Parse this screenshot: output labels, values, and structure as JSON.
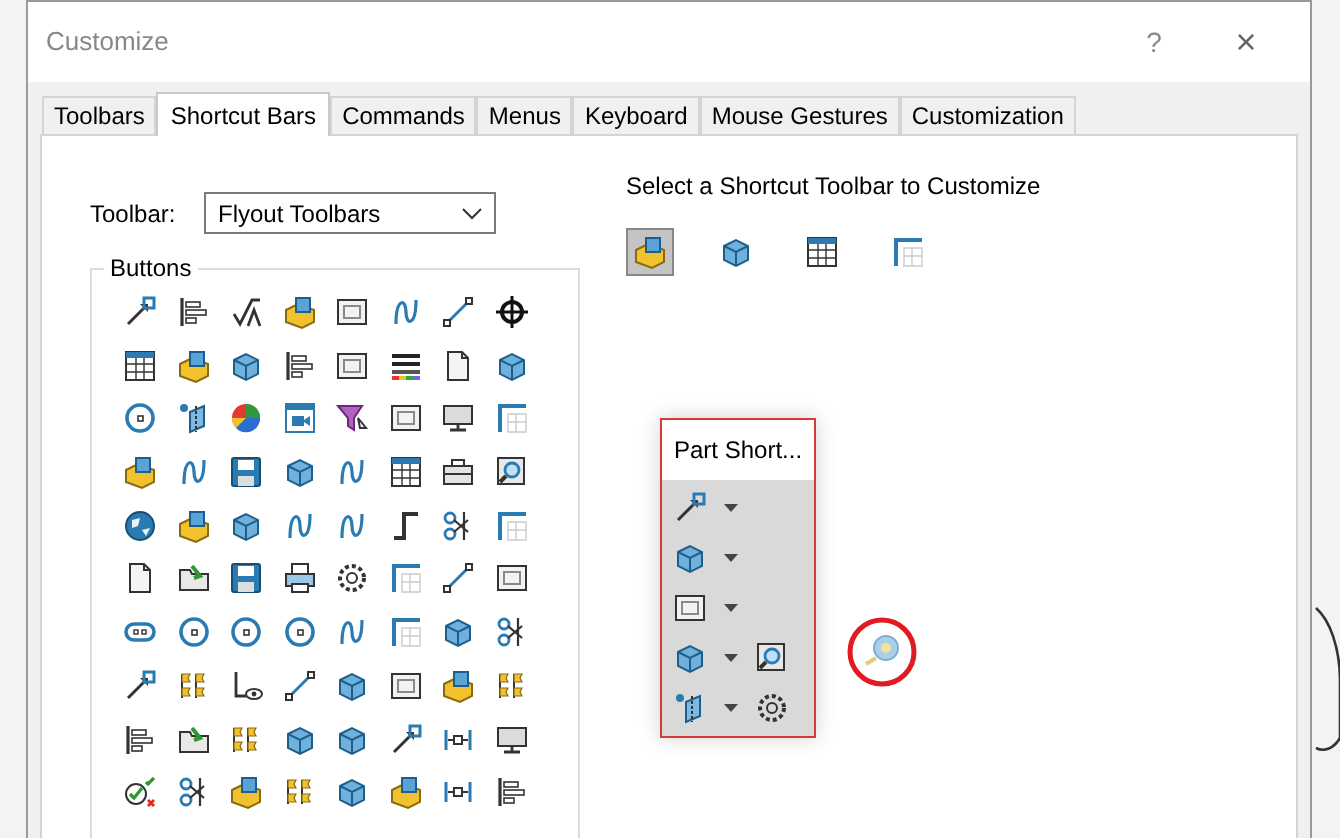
{
  "window": {
    "title": "Customize",
    "help": "?",
    "close": "×"
  },
  "tabs": [
    {
      "label": "Toolbars",
      "selected": false
    },
    {
      "label": "Shortcut Bars",
      "selected": true
    },
    {
      "label": "Commands",
      "selected": false
    },
    {
      "label": "Menus",
      "selected": false
    },
    {
      "label": "Keyboard",
      "selected": false
    },
    {
      "label": "Mouse Gestures",
      "selected": false
    },
    {
      "label": "Customization",
      "selected": false
    }
  ],
  "toolbar_field": {
    "label": "Toolbar:",
    "value": "Flyout Toolbars"
  },
  "buttons_group": {
    "title": "Buttons"
  },
  "shortcut_selector": {
    "heading": "Select a Shortcut Toolbar to Customize",
    "toolbars": [
      {
        "selected": true
      },
      {
        "selected": false
      },
      {
        "selected": false
      },
      {
        "selected": false
      }
    ]
  },
  "shortcut_bar": {
    "title": "Part Short...",
    "rows": [
      {
        "has_extra": false
      },
      {
        "has_extra": false
      },
      {
        "has_extra": false
      },
      {
        "has_extra": true
      },
      {
        "has_extra": true
      }
    ]
  }
}
